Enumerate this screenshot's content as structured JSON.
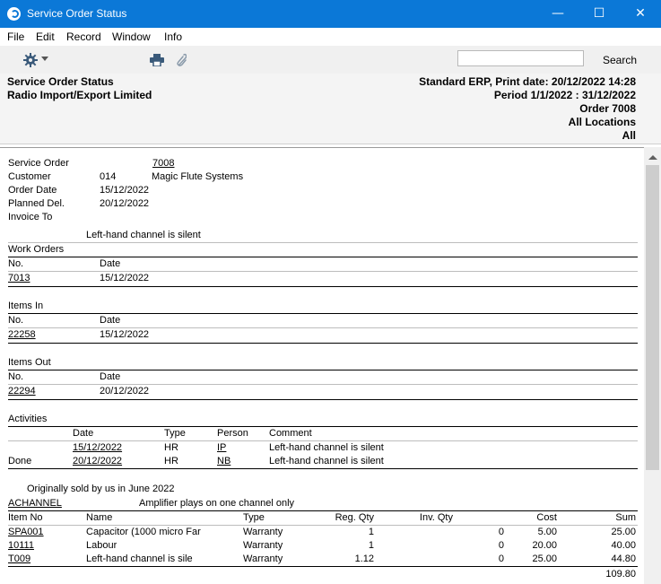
{
  "window": {
    "title": "Service Order Status",
    "controls": {
      "minimize": "—",
      "maximize": "☐",
      "close": "✕"
    }
  },
  "menu": [
    "File",
    "Edit",
    "Record",
    "Window",
    "Info"
  ],
  "toolbar": {
    "icons": [
      "gear-icon",
      "printer-icon",
      "paperclip-icon"
    ],
    "search_value": "",
    "search_label": "Search"
  },
  "header": {
    "report_name": "Service Order Status",
    "company": "Radio Import/Export Limited",
    "print_info": "Standard ERP, Print date: 20/12/2022 14:28",
    "period": "Period   1/1/2022 : 31/12/2022",
    "order": "Order 7008",
    "locations": "All Locations",
    "all": "All"
  },
  "order": {
    "service_order_label": "Service Order",
    "service_order": "7008",
    "customer_label": "Customer",
    "customer_code": "014",
    "customer_name": "Magic Flute Systems",
    "order_date_label": "Order Date",
    "order_date": "15/12/2022",
    "planned_del_label": "Planned Del.",
    "planned_del": "20/12/2022",
    "invoice_to_label": "Invoice To",
    "fault": "Left-hand channel is silent"
  },
  "work_orders": {
    "title": "Work Orders",
    "col_no": "No.",
    "col_date": "Date",
    "rows": [
      {
        "no": "7013",
        "date": "15/12/2022"
      }
    ]
  },
  "items_in": {
    "title": "Items In",
    "col_no": "No.",
    "col_date": "Date",
    "rows": [
      {
        "no": "22258",
        "date": "15/12/2022"
      }
    ]
  },
  "items_out": {
    "title": "Items Out",
    "col_no": "No.",
    "col_date": "Date",
    "rows": [
      {
        "no": "22294",
        "date": "20/12/2022"
      }
    ]
  },
  "activities": {
    "title": "Activities",
    "col_date": "Date",
    "col_type": "Type",
    "col_person": "Person",
    "col_comment": "Comment",
    "rows": [
      {
        "status": "",
        "date": "15/12/2022",
        "type": "HR",
        "person": "IP",
        "comment": "Left-hand channel is silent"
      },
      {
        "status": "Done",
        "date": "20/12/2022",
        "type": "HR",
        "person": "NB",
        "comment": "Left-hand channel is silent"
      }
    ]
  },
  "item_section": {
    "note": "Originally sold by us in June 2022",
    "item_code": "ACHANNEL",
    "item_desc": "Amplifier plays on one channel only",
    "col_item_no": "Item No",
    "col_name": "Name",
    "col_type": "Type",
    "col_reg_qty": "Reg. Qty",
    "col_inv_qty": "Inv. Qty",
    "col_cost": "Cost",
    "col_sum": "Sum",
    "rows": [
      {
        "item_no": "SPA001",
        "name": "Capacitor (1000 micro Far",
        "type": "Warranty",
        "reg_qty": "1",
        "inv_qty": "0",
        "cost": "5.00",
        "sum": "25.00"
      },
      {
        "item_no": "10111",
        "name": "Labour",
        "type": "Warranty",
        "reg_qty": "1",
        "inv_qty": "0",
        "cost": "20.00",
        "sum": "40.00"
      },
      {
        "item_no": "T009",
        "name": "Left-hand channel is sile",
        "type": "Warranty",
        "reg_qty": "1.12",
        "inv_qty": "0",
        "cost": "25.00",
        "sum": "44.80"
      }
    ],
    "total": "109.80"
  }
}
